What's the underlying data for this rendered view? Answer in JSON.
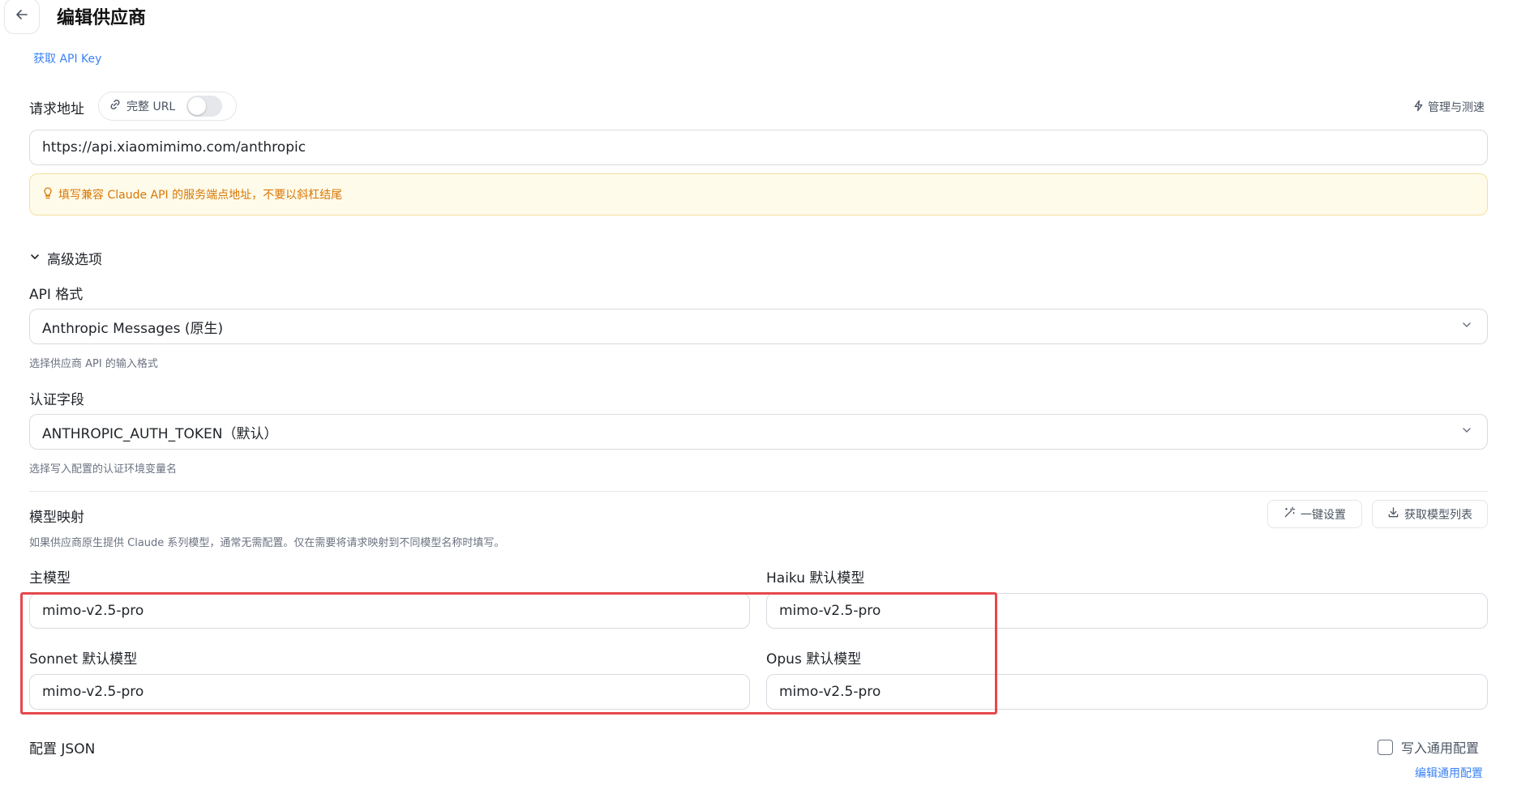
{
  "header": {
    "title": "编辑供应商"
  },
  "api_key_link": "获取 API Key",
  "endpoint": {
    "label": "请求地址",
    "full_url_label": "完整 URL",
    "full_url_enabled": false,
    "manage_label": "管理与测速",
    "value": "https://api.xiaomimimo.com/anthropic",
    "notice": "填写兼容 Claude API 的服务端点地址，不要以斜杠结尾"
  },
  "advanced": {
    "toggle_label": "高级选项",
    "expanded": true,
    "api_format": {
      "label": "API 格式",
      "selected": "Anthropic Messages (原生)",
      "hint": "选择供应商 API 的输入格式"
    },
    "auth_field": {
      "label": "认证字段",
      "selected": "ANTHROPIC_AUTH_TOKEN（默认）",
      "hint": "选择写入配置的认证环境变量名"
    }
  },
  "model_mapping": {
    "title": "模型映射",
    "description": "如果供应商原生提供 Claude 系列模型，通常无需配置。仅在需要将请求映射到不同模型名称时填写。",
    "one_click_label": "一键设置",
    "fetch_list_label": "获取模型列表",
    "main_model": {
      "label": "主模型",
      "value": "mimo-v2.5-pro"
    },
    "haiku_model": {
      "label": "Haiku 默认模型",
      "value": "mimo-v2.5-pro"
    },
    "sonnet_model": {
      "label": "Sonnet 默认模型",
      "value": "mimo-v2.5-pro"
    },
    "opus_model": {
      "label": "Opus 默认模型",
      "value": "mimo-v2.5-pro"
    }
  },
  "config_json": {
    "title": "配置 JSON",
    "write_common_label": "写入通用配置",
    "write_common_checked": false,
    "edit_common_link": "编辑通用配置"
  },
  "colors": {
    "accent": "#3b82f6",
    "notice_text": "#d97706",
    "notice_bg": "#fefbea",
    "highlight_border": "#e5484d"
  }
}
